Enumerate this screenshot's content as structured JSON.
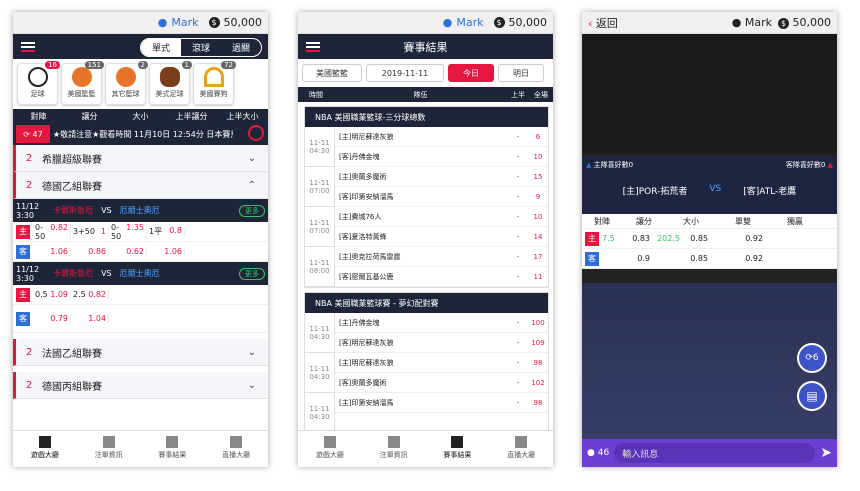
{
  "user": {
    "name": "Mark",
    "balance": "50,000"
  },
  "p1": {
    "seg": [
      "單式",
      "滾球",
      "過關"
    ],
    "sports": [
      {
        "label": "足球",
        "count": "16"
      },
      {
        "label": "美國籃籃",
        "count": "151"
      },
      {
        "label": "其它籃球",
        "count": "2"
      },
      {
        "label": "美式足球",
        "count": "1"
      },
      {
        "label": "美國賽狗",
        "count": "72"
      }
    ],
    "head": [
      "對陣",
      "讓分",
      "大小",
      "上半讓分",
      "上半大小"
    ],
    "marquee": {
      "count": "47",
      "text": "★敬請注意★觀看時間 11月10日 12:54分 日本賽馬-東"
    },
    "leagues": [
      {
        "n": "2",
        "name": "希臘超級聯賽"
      },
      {
        "n": "2",
        "name": "德國乙組聯賽"
      },
      {
        "n": "2",
        "name": "法國乙組聯賽"
      },
      {
        "n": "2",
        "name": "德國丙組聯賽"
      }
    ],
    "matches": [
      {
        "date": "11/12",
        "time": "3:30",
        "home": "卡爾斯魯厄",
        "vs": "VS",
        "away": "厄爾士奧厄",
        "more": "更多",
        "h": [
          [
            "0-50",
            "0.82"
          ],
          [
            "3+50",
            "1"
          ],
          [
            "0-50",
            "1.35"
          ],
          [
            "1平",
            "0.8"
          ]
        ],
        "a": [
          [
            "",
            "1.06"
          ],
          [
            "",
            "0.86"
          ],
          [
            "",
            "0.62"
          ],
          [
            "",
            "1.06"
          ]
        ]
      },
      {
        "date": "11/12",
        "time": "3:30",
        "home": "卡爾斯魯厄",
        "vs": "VS",
        "away": "厄爾士奧厄",
        "more": "更多",
        "h": [
          [
            "0.5",
            "1.09"
          ],
          [
            "2.5",
            "0.82"
          ],
          [
            "",
            ""
          ],
          [
            "",
            ""
          ]
        ],
        "a": [
          [
            "",
            "0.79"
          ],
          [
            "",
            "1.04"
          ],
          [
            "",
            ""
          ],
          [
            "",
            ""
          ]
        ]
      }
    ],
    "tags": {
      "h": "主",
      "a": "客"
    },
    "tabs": [
      "遊戲大廳",
      "注單資訊",
      "賽事結果",
      "直播大廳"
    ]
  },
  "p2": {
    "title": "賽事結果",
    "filters": [
      "美國籃籃",
      "2019-11-11",
      "今日",
      "明日"
    ],
    "head": [
      "時間",
      "隊伍",
      "上半",
      "全場"
    ],
    "blocks": [
      {
        "title": "NBA 美國職業籃球-三分球總數",
        "matches": [
          {
            "d": "11-11",
            "t": "04:30",
            "a": "[主]明尼蘇達灰狼",
            "b": "[客]丹佛金塊",
            "s": [
              [
                "-",
                "6"
              ],
              [
                "-",
                "10"
              ]
            ]
          },
          {
            "d": "11-11",
            "t": "07:00",
            "a": "[主]奧蘭多魔術",
            "b": "[客]印第安納溜馬",
            "s": [
              [
                "-",
                "15"
              ],
              [
                "-",
                "9"
              ]
            ]
          },
          {
            "d": "11-11",
            "t": "07:00",
            "a": "[主]費城76人",
            "b": "[客]夏洛特黃蜂",
            "s": [
              [
                "-",
                "10"
              ],
              [
                "-",
                "14"
              ]
            ]
          },
          {
            "d": "11-11",
            "t": "08:00",
            "a": "[主]奧克拉荷馬雷霆",
            "b": "[客]密爾瓦基公鹿",
            "s": [
              [
                "-",
                "17"
              ],
              [
                "-",
                "11"
              ]
            ]
          }
        ]
      },
      {
        "title": "NBA 美國職業籃球賽 - 夢幻配對賽",
        "matches": [
          {
            "d": "11-11",
            "t": "04:30",
            "a": "[主]丹佛金塊",
            "b": "[客]明尼蘇達灰狼",
            "s": [
              [
                "-",
                "100"
              ],
              [
                "-",
                "109"
              ]
            ]
          },
          {
            "d": "11-11",
            "t": "04:30",
            "a": "[主]明尼蘇達灰狼",
            "b": "[客]奧蘭多魔術",
            "s": [
              [
                "-",
                "98"
              ],
              [
                "-",
                "102"
              ]
            ]
          },
          {
            "d": "11-11",
            "t": "04:30",
            "a": "[主]印第安納溜馬",
            "b": "",
            "s": [
              [
                "-",
                "98"
              ],
              [
                "",
                ""
              ]
            ]
          }
        ]
      }
    ],
    "tabs": [
      "遊戲大廳",
      "注單資訊",
      "賽事結果",
      "直播大廳"
    ]
  },
  "p3": {
    "back": "返回",
    "like_home": "主隊喜好數0",
    "like_away": "客隊喜好數0",
    "home": "[主]POR-拓荒者",
    "vs": "VS",
    "away": "[客]ATL-老鷹",
    "head": [
      "對陣",
      "讓分",
      "大小",
      "單雙",
      "獨贏"
    ],
    "h": [
      "7.5",
      "0.83",
      "202.5",
      "0.85",
      "0.92"
    ],
    "a": [
      "",
      "0.9",
      "",
      "0.85",
      "0.92"
    ],
    "fab_count": "6",
    "online": "46",
    "placeholder": "輸入訊息"
  }
}
